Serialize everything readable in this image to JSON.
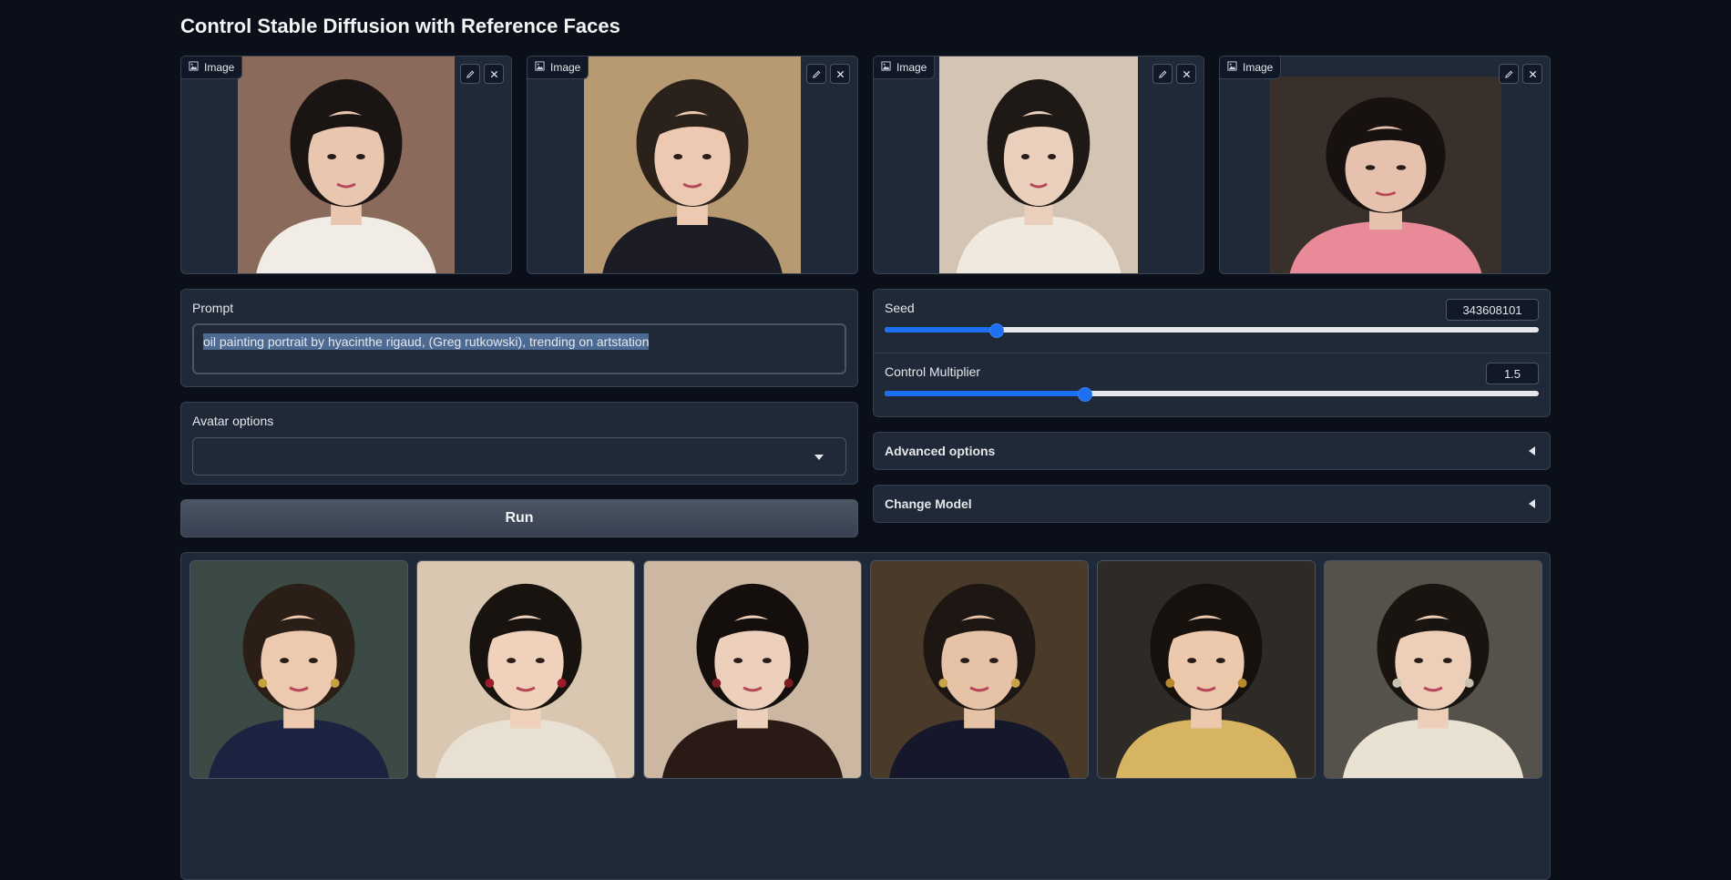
{
  "page_title": "Control Stable Diffusion with Reference Faces",
  "image_inputs": [
    {
      "label": "Image",
      "icon": "image-icon",
      "bg": "#8a6a5a",
      "hair": "#1a1412",
      "skin": "#e8c6b0",
      "cloth": "#f1ede6"
    },
    {
      "label": "Image",
      "icon": "image-icon",
      "bg": "#b89a72",
      "hair": "#2a211b",
      "skin": "#ecc9b0",
      "cloth": "#1c1c24"
    },
    {
      "label": "Image",
      "icon": "image-icon",
      "bg": "#d4c4b4",
      "hair": "#1e1915",
      "skin": "#ead0bc",
      "cloth": "#efe9df"
    },
    {
      "label": "Image",
      "icon": "image-icon",
      "bg": "#3a302b",
      "hair": "#17120f",
      "skin": "#e6c1ae",
      "cloth": "#e88a97"
    }
  ],
  "prompt": {
    "label": "Prompt",
    "value": "oil painting portrait by hyacinthe rigaud, (Greg rutkowski), trending on artstation"
  },
  "avatar_options": {
    "label": "Avatar options",
    "selected": ""
  },
  "run_label": "Run",
  "seed": {
    "label": "Seed",
    "value": "343608101",
    "fraction": 0.17
  },
  "control_multiplier": {
    "label": "Control Multiplier",
    "value": "1.5",
    "fraction": 0.305
  },
  "advanced_options_label": "Advanced options",
  "change_model_label": "Change Model",
  "gallery": [
    {
      "bg": "#3c4a46",
      "hair": "#2b1e17",
      "skin": "#edc9b0",
      "cloth": "#1b2340",
      "accent": "#c8a040"
    },
    {
      "bg": "#d9c7b2",
      "hair": "#18130f",
      "skin": "#f0d2bc",
      "cloth": "#e8e0d2",
      "accent": "#9c1d2a"
    },
    {
      "bg": "#cbb7a2",
      "hair": "#140f0d",
      "skin": "#edd0bc",
      "cloth": "#2a1a16",
      "accent": "#7a1c22"
    },
    {
      "bg": "#4a3a2a",
      "hair": "#1d1612",
      "skin": "#e6c3a6",
      "cloth": "#15182a",
      "accent": "#c9a24b"
    },
    {
      "bg": "#2e2a26",
      "hair": "#17110d",
      "skin": "#ecc9ad",
      "cloth": "#d7b462",
      "accent": "#b88a2e"
    },
    {
      "bg": "#54524a",
      "hair": "#1a1411",
      "skin": "#edceb8",
      "cloth": "#e9e2d3",
      "accent": "#c8c2b0"
    }
  ],
  "colors": {
    "accent": "#1d6ff2",
    "panel_bg": "#1f2937",
    "page_bg": "#0b0f19"
  }
}
